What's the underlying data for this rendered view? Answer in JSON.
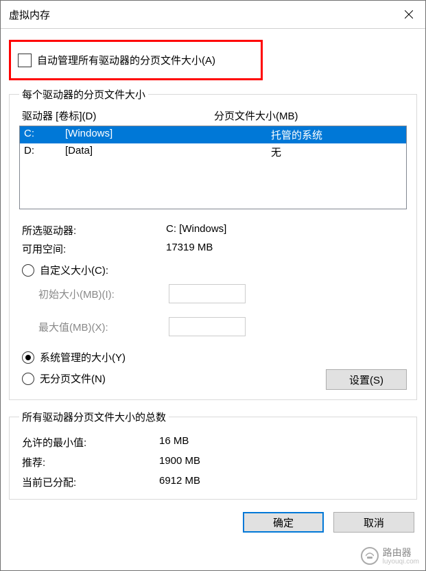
{
  "window": {
    "title": "虚拟内存"
  },
  "auto_manage": {
    "label": "自动管理所有驱动器的分页文件大小(A)",
    "checked": false
  },
  "per_drive": {
    "group_title": "每个驱动器的分页文件大小",
    "header_drive": "驱动器 [卷标](D)",
    "header_size": "分页文件大小(MB)",
    "rows": [
      {
        "letter": "C:",
        "label": "[Windows]",
        "size": "托管的系统",
        "selected": true
      },
      {
        "letter": "D:",
        "label": "[Data]",
        "size": "无",
        "selected": false
      }
    ],
    "selected_drive_label": "所选驱动器:",
    "selected_drive_value": "C:  [Windows]",
    "available_label": "可用空间:",
    "available_value": "17319 MB",
    "custom_size_label": "自定义大小(C):",
    "initial_label": "初始大小(MB)(I):",
    "max_label": "最大值(MB)(X):",
    "system_managed_label": "系统管理的大小(Y)",
    "no_paging_label": "无分页文件(N)",
    "set_button": "设置(S)",
    "size_mode": "system_managed"
  },
  "totals": {
    "group_title": "所有驱动器分页文件大小的总数",
    "min_label": "允许的最小值:",
    "min_value": "16 MB",
    "rec_label": "推荐:",
    "rec_value": "1900 MB",
    "cur_label": "当前已分配:",
    "cur_value": "6912 MB"
  },
  "buttons": {
    "ok": "确定",
    "cancel": "取消"
  },
  "watermark": {
    "text": "路由器",
    "sub": "luyouqi.com"
  }
}
